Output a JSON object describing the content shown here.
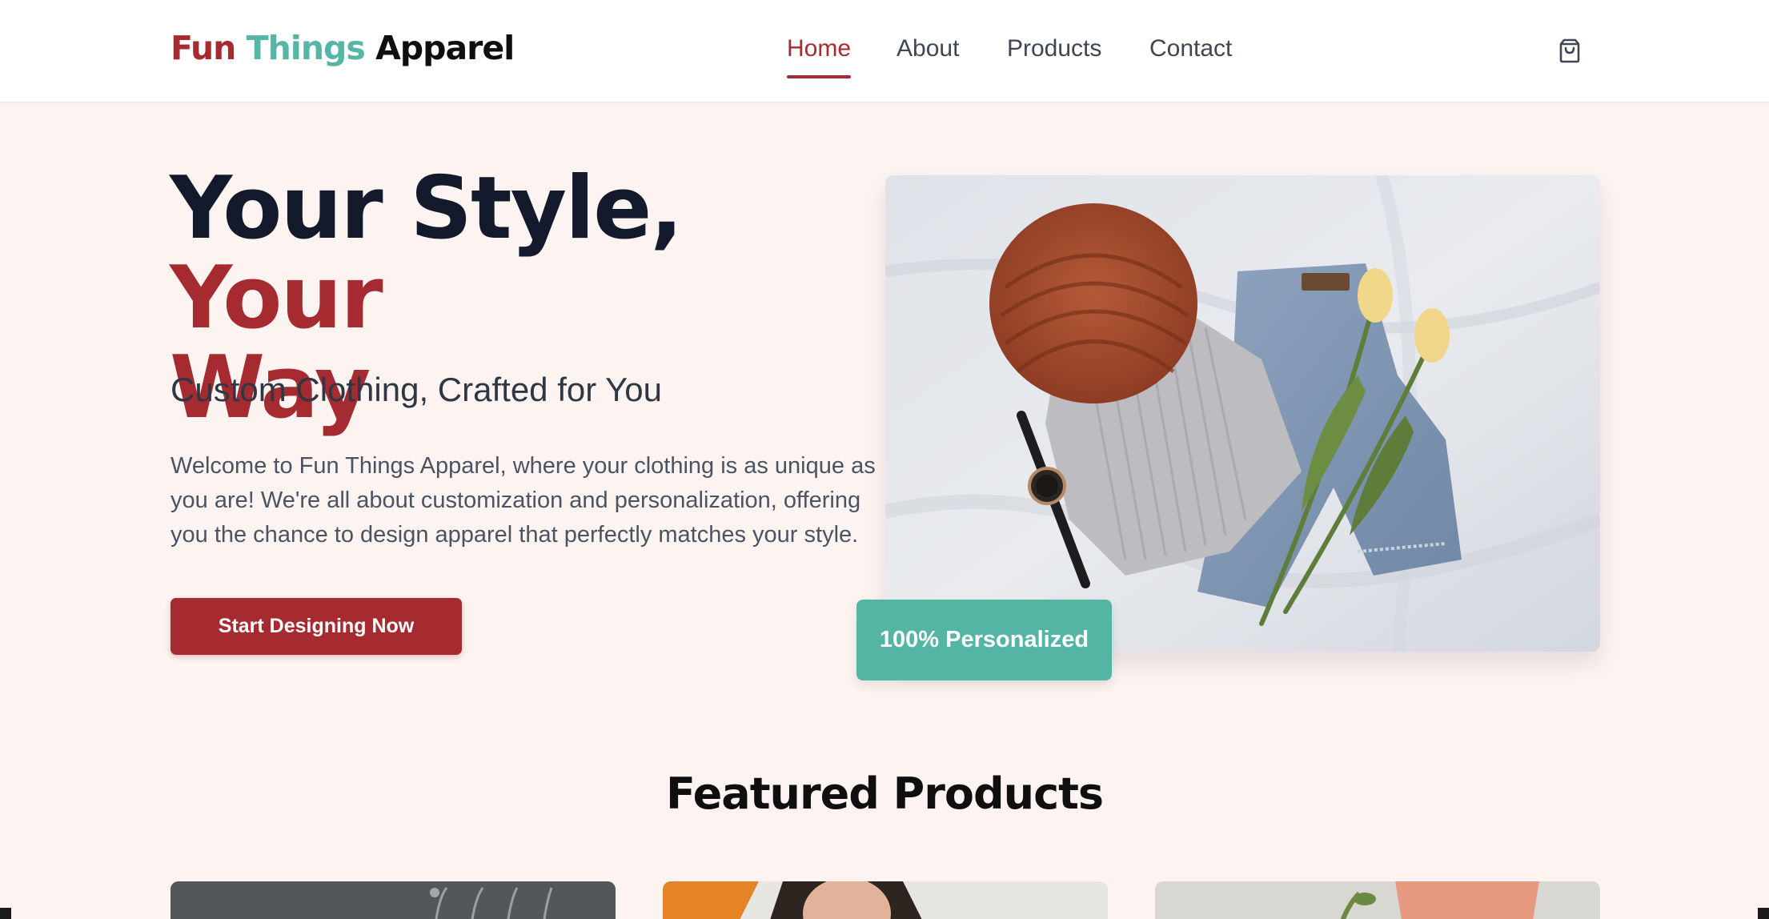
{
  "brand": {
    "part1": "Fun",
    "part2": "Things",
    "part3": "Apparel",
    "colors": {
      "primary": "#a62b31",
      "teal": "#57b5a6",
      "dark": "#0f0f10"
    }
  },
  "nav": {
    "items": [
      {
        "label": "Home",
        "active": true
      },
      {
        "label": "About",
        "active": false
      },
      {
        "label": "Products",
        "active": false
      },
      {
        "label": "Contact",
        "active": false
      }
    ],
    "cart_icon": "shopping-bag-icon"
  },
  "hero": {
    "title_part1": "Your Style,",
    "title_part2": "Your",
    "title_part3": "Way",
    "subtitle": "Custom Clothing, Crafted for You",
    "description": "Welcome to Fun Things Apparel, where your clothing is as unique as you are! We're all about customization and personalization, offering you the chance to design apparel that perfectly matches your style.",
    "cta_label": "Start Designing Now",
    "badge": "100% Personalized"
  },
  "featured": {
    "title": "Featured Products"
  }
}
